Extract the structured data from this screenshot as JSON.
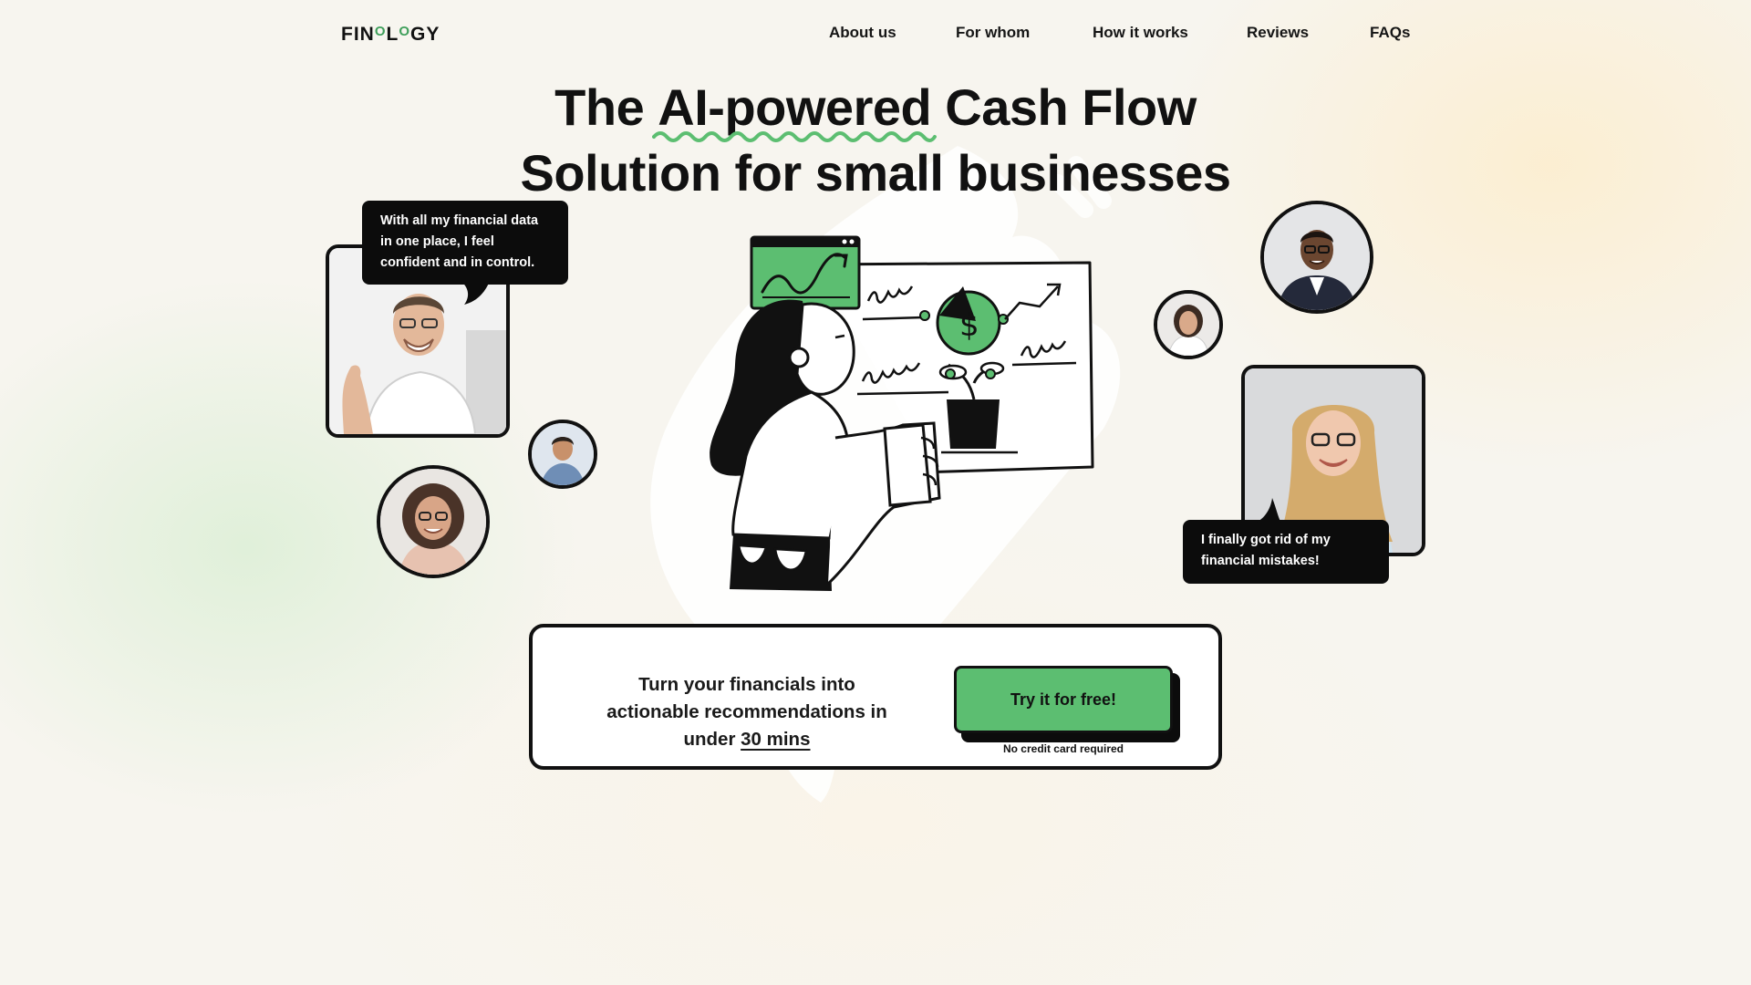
{
  "nav": {
    "logo": {
      "part1": "FIN",
      "part2": "O",
      "part3": "L",
      "part4": "O",
      "part5": "GY"
    },
    "links": [
      {
        "label": "About us"
      },
      {
        "label": "For whom"
      },
      {
        "label": "How it works"
      },
      {
        "label": "Reviews"
      },
      {
        "label": "FAQs"
      }
    ]
  },
  "hero": {
    "title_pre": "The ",
    "title_highlight": "AI-powered",
    "title_post": " Cash Flow",
    "title_line2": "Solution for small businesses",
    "accent_color": "#5cbe71"
  },
  "testimonials": {
    "quote1": "With all my financial data in one place, I feel confident and in control.",
    "quote2": "I finally got rid of my financial mistakes!"
  },
  "cta": {
    "text_main": "Turn your financials into actionable recommendations in under ",
    "text_highlight": "30 mins",
    "button_label": "Try it for free!",
    "note": "No credit card required"
  },
  "icons": [
    "squiggle-underline-icon",
    "growth-chart-icon",
    "pie-chart-icon",
    "dollar-icon",
    "plant-icon",
    "arrow-up-icon"
  ]
}
